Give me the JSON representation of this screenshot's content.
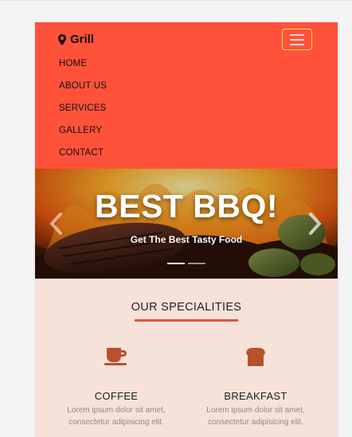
{
  "header": {
    "brand": "Grill",
    "menu": [
      "HOME",
      "ABOUT US",
      "SERVICES",
      "GALLERY",
      "CONTACT"
    ]
  },
  "hero": {
    "title": "BEST BBQ!",
    "subtitle": "Get The Best Tasty Food",
    "slides_count": 2,
    "active_slide": 1
  },
  "specialities": {
    "title": "OUR SPECIALITIES",
    "items": [
      {
        "icon": "coffee-cup-icon",
        "name": "COFFEE",
        "text": "Lorem ipsum dolor sit amet, consectetur adipisicing elit."
      },
      {
        "icon": "bread-icon",
        "name": "BREAKFAST",
        "text": "Lorem ipsum dolor sit amet, consectetur adipisicing elit."
      }
    ]
  },
  "colors": {
    "brand": "#ff523b",
    "section_bg": "#f6e2d9",
    "accent": "#e5533d",
    "icon": "#b7522d"
  }
}
